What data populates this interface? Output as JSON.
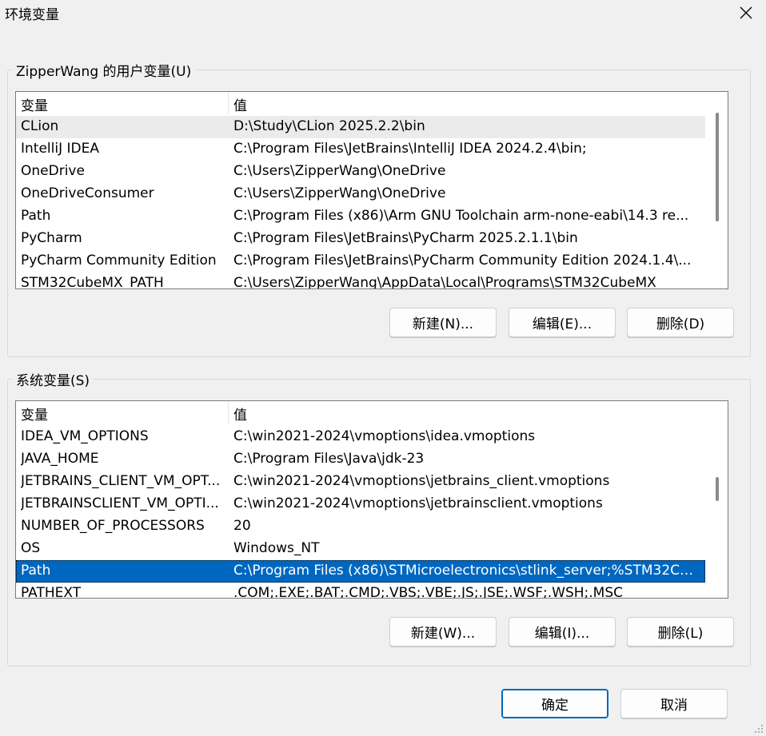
{
  "window": {
    "title": "环境变量"
  },
  "user_vars": {
    "group_label": "ZipperWang 的用户变量(U)",
    "headers": {
      "name": "变量",
      "value": "值"
    },
    "rows": [
      {
        "name": "CLion",
        "value": "D:\\Study\\CLion 2025.2.2\\bin"
      },
      {
        "name": "IntelliJ IDEA",
        "value": "C:\\Program Files\\JetBrains\\IntelliJ IDEA 2024.2.4\\bin;"
      },
      {
        "name": "OneDrive",
        "value": "C:\\Users\\ZipperWang\\OneDrive"
      },
      {
        "name": "OneDriveConsumer",
        "value": "C:\\Users\\ZipperWang\\OneDrive"
      },
      {
        "name": "Path",
        "value": "C:\\Program Files (x86)\\Arm GNU Toolchain arm-none-eabi\\14.3 re..."
      },
      {
        "name": "PyCharm",
        "value": "C:\\Program Files\\JetBrains\\PyCharm 2025.2.1.1\\bin"
      },
      {
        "name": "PyCharm Community Edition",
        "value": "C:\\Program Files\\JetBrains\\PyCharm Community Edition 2024.1.4\\..."
      },
      {
        "name": "STM32CubeMX_PATH",
        "value": "C:\\Users\\ZipperWang\\AppData\\Local\\Programs\\STM32CubeMX"
      }
    ],
    "buttons": {
      "new": "新建(N)...",
      "edit": "编辑(E)...",
      "delete": "删除(D)"
    }
  },
  "system_vars": {
    "group_label": "系统变量(S)",
    "headers": {
      "name": "变量",
      "value": "值"
    },
    "rows": [
      {
        "name": "IDEA_VM_OPTIONS",
        "value": "C:\\win2021-2024\\vmoptions\\idea.vmoptions"
      },
      {
        "name": "JAVA_HOME",
        "value": "C:\\Program Files\\Java\\jdk-23"
      },
      {
        "name": "JETBRAINS_CLIENT_VM_OPT...",
        "value": "C:\\win2021-2024\\vmoptions\\jetbrains_client.vmoptions"
      },
      {
        "name": "JETBRAINSCLIENT_VM_OPTI...",
        "value": "C:\\win2021-2024\\vmoptions\\jetbrainsclient.vmoptions"
      },
      {
        "name": "NUMBER_OF_PROCESSORS",
        "value": "20"
      },
      {
        "name": "OS",
        "value": "Windows_NT"
      },
      {
        "name": "Path",
        "value": "C:\\Program Files (x86)\\STMicroelectronics\\stlink_server;%STM32CL..."
      },
      {
        "name": "PATHEXT",
        "value": ".COM;.EXE;.BAT;.CMD;.VBS;.VBE;.JS;.JSE;.WSF;.WSH;.MSC"
      }
    ],
    "buttons": {
      "new": "新建(W)...",
      "edit": "编辑(I)...",
      "delete": "删除(L)"
    }
  },
  "footer": {
    "ok": "确定",
    "cancel": "取消"
  },
  "colors": {
    "selection": "#0067c0",
    "hover": "#ebebeb",
    "primary_border": "#0067c0"
  },
  "icons": {
    "close": "close-icon",
    "grip": "resize-grip-icon"
  }
}
